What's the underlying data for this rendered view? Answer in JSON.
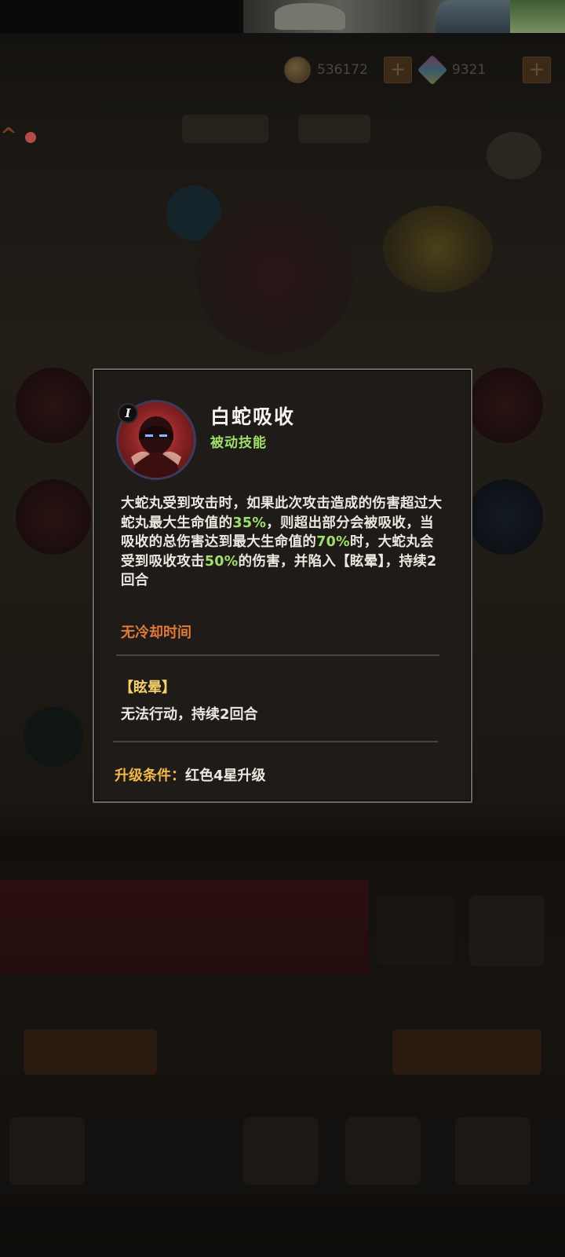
{
  "currency": {
    "coins": "536172",
    "gems": "9321",
    "plus": "+"
  },
  "topbar": {
    "glyph": "^"
  },
  "skill": {
    "name": "白蛇吸收",
    "type": "被动技能",
    "level": "I",
    "description_parts": [
      {
        "text": "大蛇丸受到攻击时，如果此次攻击造成的伤害超过大蛇丸最大生命值的",
        "hl": false
      },
      {
        "text": "35%",
        "hl": true
      },
      {
        "text": "，则超出部分会被吸收，当吸收的总伤害达到最大生命值的",
        "hl": false
      },
      {
        "text": "70%",
        "hl": true
      },
      {
        "text": "时，大蛇丸会受到吸收攻击",
        "hl": false
      },
      {
        "text": "50%",
        "hl": true
      },
      {
        "text": "的伤害，并陷入【眩晕】，持续2回合",
        "hl": false
      }
    ],
    "cooldown": "无冷却时间",
    "status_title": "【眩晕】",
    "status_desc": "无法行动，持续2回合",
    "upgrade_label": "升级条件：",
    "upgrade_value": "红色4星升级"
  },
  "colors": {
    "highlight": "#9fe06a",
    "cooldown": "#e27a3a",
    "status_title": "#f4d06a",
    "upgrade_label": "#f1b84a",
    "popup_bg": "#1f1b19",
    "popup_border": "#6f6760"
  },
  "icons": {
    "coin": "coin-icon",
    "gem": "gem-icon",
    "avatar": "orochimaru-portrait",
    "badge": "level-badge"
  }
}
